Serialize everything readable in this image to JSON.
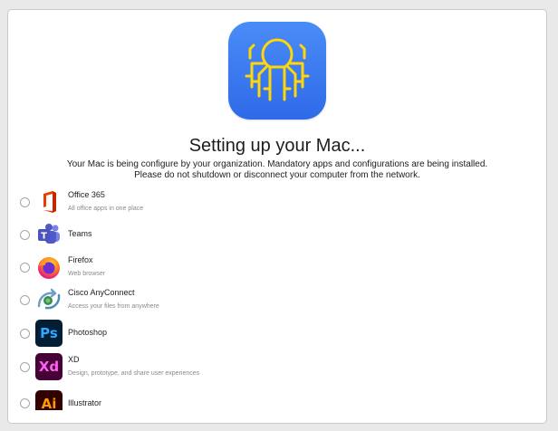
{
  "header": {
    "title": "Setting up your Mac...",
    "subtitle_line1": "Your Mac is being configure by your organization. Mandatory apps and configurations are being installed.",
    "subtitle_line2": "Please do not shutdown or disconnect your computer from the network."
  },
  "colors": {
    "hero_icon_bg": "#3478f6",
    "hero_icon_fg": "#ffd60a"
  },
  "apps": [
    {
      "name": "Office 365",
      "description": "All office apps in one place",
      "icon": "office-365-icon"
    },
    {
      "name": "Teams",
      "description": "",
      "icon": "teams-icon"
    },
    {
      "name": "Firefox",
      "description": "Web browser",
      "icon": "firefox-icon"
    },
    {
      "name": "Cisco AnyConnect",
      "description": "Access your files from anywhere",
      "icon": "cisco-anyconnect-icon"
    },
    {
      "name": "Photoshop",
      "description": "",
      "icon": "photoshop-icon",
      "glyph": "Ps"
    },
    {
      "name": "XD",
      "description": "Design, prototype, and share user experiences",
      "icon": "xd-icon",
      "glyph": "Xd"
    },
    {
      "name": "Illustrator",
      "description": "",
      "icon": "illustrator-icon",
      "glyph": "Ai"
    }
  ]
}
